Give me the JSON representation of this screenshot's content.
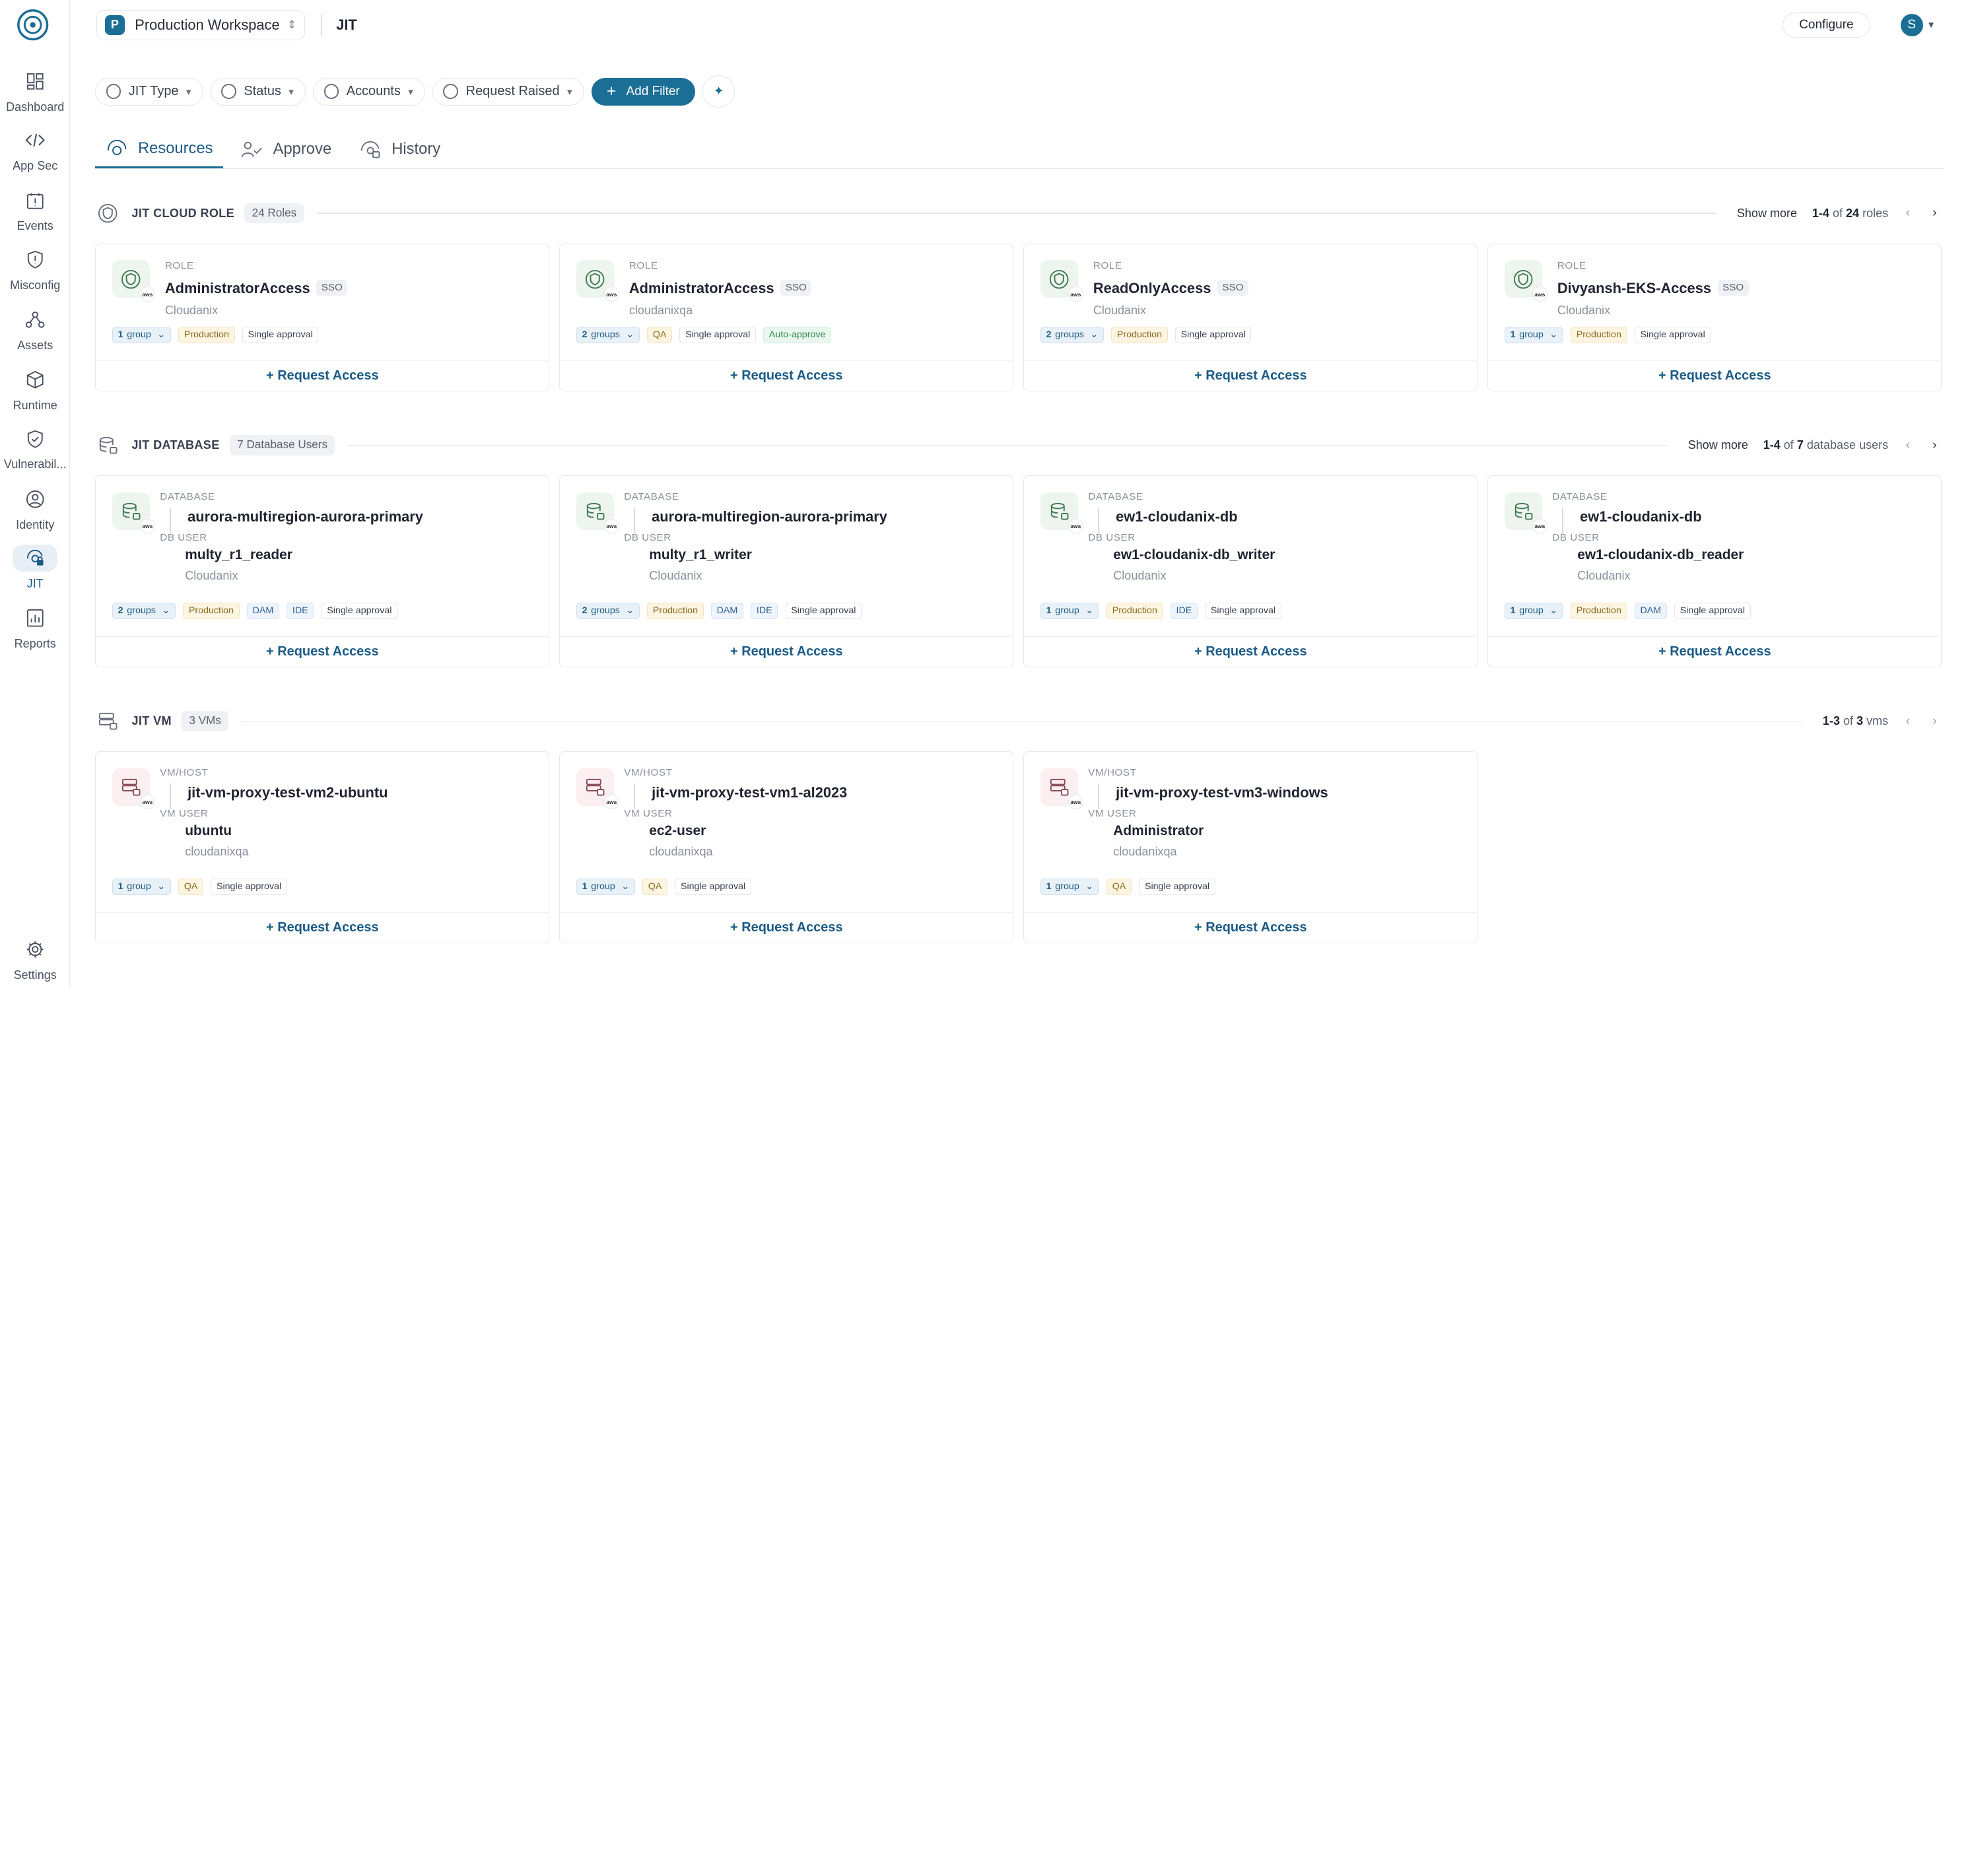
{
  "sidebar": {
    "items": [
      {
        "label": "Dashboard",
        "icon": "dashboard-icon"
      },
      {
        "label": "App Sec",
        "icon": "code-icon"
      },
      {
        "label": "Events",
        "icon": "calendar-alert-icon"
      },
      {
        "label": "Misconfig",
        "icon": "shield-alert-icon"
      },
      {
        "label": "Assets",
        "icon": "nodes-icon"
      },
      {
        "label": "Runtime",
        "icon": "cube-icon"
      },
      {
        "label": "Vulnerabil...",
        "icon": "shield-check-icon"
      },
      {
        "label": "Identity",
        "icon": "identity-icon"
      },
      {
        "label": "JIT",
        "icon": "jit-icon",
        "active": true
      },
      {
        "label": "Reports",
        "icon": "reports-icon"
      },
      {
        "label": "Settings",
        "icon": "gear-icon"
      }
    ]
  },
  "header": {
    "workspace_initial": "P",
    "workspace_name": "Production Workspace",
    "page_title": "JIT",
    "configure_label": "Configure",
    "avatar_initial": "S"
  },
  "filters": {
    "chips": [
      "JIT Type",
      "Status",
      "Accounts",
      "Request Raised"
    ],
    "add_filter_label": "Add Filter"
  },
  "tabs": [
    {
      "label": "Resources",
      "active": true
    },
    {
      "label": "Approve"
    },
    {
      "label": "History"
    }
  ],
  "sections": {
    "cloud_role": {
      "title": "JIT CLOUD ROLE",
      "count": "24 Roles",
      "show_more": "Show more",
      "range": "1-4",
      "of": "of",
      "total": "24",
      "unit": "roles",
      "cards": [
        {
          "kicker": "ROLE",
          "name": "AdministratorAccess",
          "badge": "SSO",
          "account": "Cloudanix",
          "groups_n": "1",
          "groups_word": "group",
          "tags": [
            "Production",
            "Single approval"
          ],
          "request": "+ Request Access"
        },
        {
          "kicker": "ROLE",
          "name": "AdministratorAccess",
          "badge": "SSO",
          "account": "cloudanixqa",
          "groups_n": "2",
          "groups_word": "groups",
          "tags": [
            "QA",
            "Single approval",
            "Auto-approve"
          ],
          "request": "+ Request Access"
        },
        {
          "kicker": "ROLE",
          "name": "ReadOnlyAccess",
          "badge": "SSO",
          "account": "Cloudanix",
          "groups_n": "2",
          "groups_word": "groups",
          "tags": [
            "Production",
            "Single approval"
          ],
          "request": "+ Request Access"
        },
        {
          "kicker": "ROLE",
          "name": "Divyansh-EKS-Access",
          "badge": "SSO",
          "account": "Cloudanix",
          "groups_n": "1",
          "groups_word": "group",
          "tags": [
            "Production",
            "Single approval"
          ],
          "request": "+ Request Access"
        }
      ]
    },
    "database": {
      "title": "JIT DATABASE",
      "count": "7 Database Users",
      "show_more": "Show more",
      "range": "1-4",
      "of": "of",
      "total": "7",
      "unit": "database users",
      "cards": [
        {
          "kicker": "DATABASE",
          "name": "aurora-multiregion-aurora-primary",
          "user_kicker": "DB USER",
          "user": "multy_r1_reader",
          "account": "Cloudanix",
          "groups_n": "2",
          "groups_word": "groups",
          "tags": [
            "Production",
            "DAM",
            "IDE",
            "Single approval"
          ],
          "request": "+ Request Access"
        },
        {
          "kicker": "DATABASE",
          "name": "aurora-multiregion-aurora-primary",
          "user_kicker": "DB USER",
          "user": "multy_r1_writer",
          "account": "Cloudanix",
          "groups_n": "2",
          "groups_word": "groups",
          "tags": [
            "Production",
            "DAM",
            "IDE",
            "Single approval"
          ],
          "request": "+ Request Access"
        },
        {
          "kicker": "DATABASE",
          "name": "ew1-cloudanix-db",
          "user_kicker": "DB USER",
          "user": "ew1-cloudanix-db_writer",
          "account": "Cloudanix",
          "groups_n": "1",
          "groups_word": "group",
          "tags": [
            "Production",
            "IDE",
            "Single approval"
          ],
          "request": "+ Request Access"
        },
        {
          "kicker": "DATABASE",
          "name": "ew1-cloudanix-db",
          "user_kicker": "DB USER",
          "user": "ew1-cloudanix-db_reader",
          "account": "Cloudanix",
          "groups_n": "1",
          "groups_word": "group",
          "tags": [
            "Production",
            "DAM",
            "Single approval"
          ],
          "request": "+ Request Access"
        }
      ]
    },
    "vm": {
      "title": "JIT VM",
      "count": "3 VMs",
      "range": "1-3",
      "of": "of",
      "total": "3",
      "unit": "vms",
      "cards": [
        {
          "kicker": "VM/HOST",
          "name": "jit-vm-proxy-test-vm2-ubuntu",
          "user_kicker": "VM USER",
          "user": "ubuntu",
          "account": "cloudanixqa",
          "groups_n": "1",
          "groups_word": "group",
          "tags": [
            "QA",
            "Single approval"
          ],
          "request": "+ Request Access"
        },
        {
          "kicker": "VM/HOST",
          "name": "jit-vm-proxy-test-vm1-al2023",
          "user_kicker": "VM USER",
          "user": "ec2-user",
          "account": "cloudanixqa",
          "groups_n": "1",
          "groups_word": "group",
          "tags": [
            "QA",
            "Single approval"
          ],
          "request": "+ Request Access"
        },
        {
          "kicker": "VM/HOST",
          "name": "jit-vm-proxy-test-vm3-windows",
          "user_kicker": "VM USER",
          "user": "Administrator",
          "account": "cloudanixqa",
          "groups_n": "1",
          "groups_word": "group",
          "tags": [
            "QA",
            "Single approval"
          ],
          "request": "+ Request Access"
        }
      ]
    }
  },
  "aws_mark": "aws",
  "colors": {
    "accent": "#1b6e95",
    "link": "#1b5b86"
  }
}
